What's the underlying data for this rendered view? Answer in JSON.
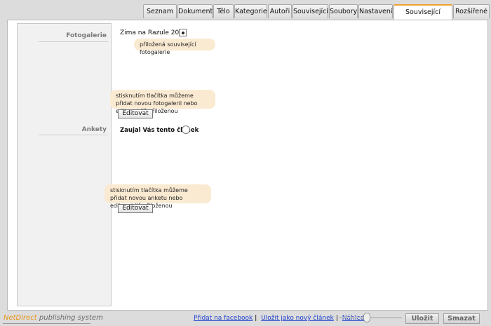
{
  "tabs": [
    "Seznam",
    "Dokument",
    "Tělo",
    "Kategorie",
    "Autoři",
    "Související",
    "Soubory",
    "Nastavení",
    "Související moduly",
    "Rozšířené"
  ],
  "active_tab": "Související moduly",
  "sections": {
    "fotogalerie": {
      "label": "Fotogalerie",
      "item": "Zima na Razule 2011",
      "tooltip": "přiložená související fotogalerie",
      "hint": "stisknutím tlačítka můžeme přidat novou fotogalerii nebo editovat již přiloženou",
      "edit_button": "Editovat"
    },
    "ankety": {
      "label": "Ankety",
      "item": "Zaujal Vás tento článek",
      "hint": "stisknutím tlačítka můžeme přidat novou anketu nebo editovat již přiloženou",
      "edit_button": "Editovat"
    }
  },
  "footer": {
    "brand_net": "NetDirect",
    "brand_rest": " publishing system",
    "links": [
      "Přidat na facebook",
      "Uložit jako nový článek",
      "Náhled"
    ],
    "save_button": "Uložit",
    "delete_button": "Smazat"
  },
  "colors": {
    "accent": "#f0a030",
    "bubble": "#fbead2",
    "link": "#1b3fd0"
  }
}
